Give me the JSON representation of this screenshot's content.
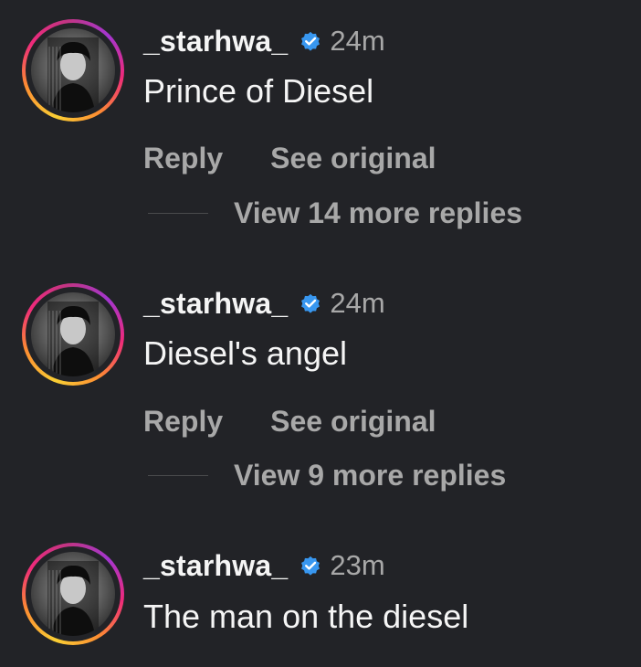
{
  "colors": {
    "background": "#222327",
    "primary_text": "#f5f5f5",
    "secondary_text": "#a8a8a8",
    "verified_badge": "#3897f0"
  },
  "comments": [
    {
      "username": "_starhwa_",
      "verified_icon": "verified-badge-icon",
      "time": "24m",
      "text": "Prince of Diesel",
      "reply_label": "Reply",
      "see_original_label": "See original",
      "view_more_label": "View 14 more replies"
    },
    {
      "username": "_starhwa_",
      "verified_icon": "verified-badge-icon",
      "time": "24m",
      "text": "Diesel's angel",
      "reply_label": "Reply",
      "see_original_label": "See original",
      "view_more_label": "View 9 more replies"
    },
    {
      "username": "_starhwa_",
      "verified_icon": "verified-badge-icon",
      "time": "23m",
      "text": "The man on the diesel"
    }
  ]
}
